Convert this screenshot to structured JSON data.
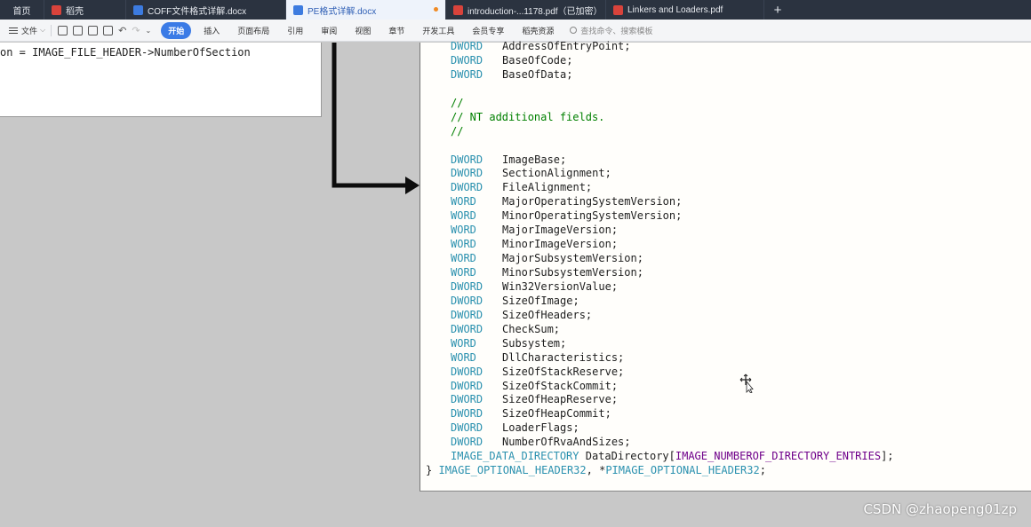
{
  "tabs": [
    {
      "label": "首页",
      "icon": null
    },
    {
      "label": "稻壳",
      "icon": "docer-icon"
    },
    {
      "label": "COFF文件格式详解.docx",
      "icon": "word-doc-icon"
    },
    {
      "label": "PE格式详解.docx",
      "icon": "word-doc-icon",
      "active": true,
      "unsaved": true
    },
    {
      "label": "introduction-...1178.pdf（已加密）",
      "icon": "pdf-icon"
    },
    {
      "label": "Linkers and Loaders.pdf",
      "icon": "pdf-icon"
    }
  ],
  "new_tab_label": "+",
  "ribbon": {
    "file_label": "文件",
    "tabs": [
      "开始",
      "插入",
      "页面布局",
      "引用",
      "审阅",
      "视图",
      "章节",
      "开发工具",
      "会员专享",
      "稻壳资源"
    ],
    "active_tab": "开始",
    "search_placeholder": "查找命令、搜索模板"
  },
  "left_doc": {
    "code_line": "on = IMAGE_FILE_HEADER->NumberOfSection"
  },
  "code_lines": [
    {
      "kind": "field",
      "type": "DWORD",
      "name": "AddressOfEntryPoint;"
    },
    {
      "kind": "field",
      "type": "DWORD",
      "name": "BaseOfCode;"
    },
    {
      "kind": "field",
      "type": "DWORD",
      "name": "BaseOfData;"
    },
    {
      "kind": "blank"
    },
    {
      "kind": "comment",
      "text": "//"
    },
    {
      "kind": "comment",
      "text": "// NT additional fields."
    },
    {
      "kind": "comment",
      "text": "//"
    },
    {
      "kind": "blank"
    },
    {
      "kind": "field",
      "type": "DWORD",
      "name": "ImageBase;"
    },
    {
      "kind": "field",
      "type": "DWORD",
      "name": "SectionAlignment;"
    },
    {
      "kind": "field",
      "type": "DWORD",
      "name": "FileAlignment;"
    },
    {
      "kind": "field",
      "type": "WORD",
      "name": "MajorOperatingSystemVersion;"
    },
    {
      "kind": "field",
      "type": "WORD",
      "name": "MinorOperatingSystemVersion;"
    },
    {
      "kind": "field",
      "type": "WORD",
      "name": "MajorImageVersion;"
    },
    {
      "kind": "field",
      "type": "WORD",
      "name": "MinorImageVersion;"
    },
    {
      "kind": "field",
      "type": "WORD",
      "name": "MajorSubsystemVersion;"
    },
    {
      "kind": "field",
      "type": "WORD",
      "name": "MinorSubsystemVersion;"
    },
    {
      "kind": "field",
      "type": "DWORD",
      "name": "Win32VersionValue;"
    },
    {
      "kind": "field",
      "type": "DWORD",
      "name": "SizeOfImage;"
    },
    {
      "kind": "field",
      "type": "DWORD",
      "name": "SizeOfHeaders;"
    },
    {
      "kind": "field",
      "type": "DWORD",
      "name": "CheckSum;"
    },
    {
      "kind": "field",
      "type": "WORD",
      "name": "Subsystem;"
    },
    {
      "kind": "field",
      "type": "WORD",
      "name": "DllCharacteristics;"
    },
    {
      "kind": "field",
      "type": "DWORD",
      "name": "SizeOfStackReserve;"
    },
    {
      "kind": "field",
      "type": "DWORD",
      "name": "SizeOfStackCommit;"
    },
    {
      "kind": "field",
      "type": "DWORD",
      "name": "SizeOfHeapReserve;"
    },
    {
      "kind": "field",
      "type": "DWORD",
      "name": "SizeOfHeapCommit;"
    },
    {
      "kind": "field",
      "type": "DWORD",
      "name": "LoaderFlags;"
    },
    {
      "kind": "field",
      "type": "DWORD",
      "name": "NumberOfRvaAndSizes;"
    }
  ],
  "data_directory_line": {
    "type": "IMAGE_DATA_DIRECTORY",
    "name": " DataDirectory[",
    "macro": "IMAGE_NUMBEROF_DIRECTORY_ENTRIES",
    "end": "];"
  },
  "closing_line": {
    "brace": "}",
    "type1": "IMAGE_OPTIONAL_HEADER32",
    "sep": ", *",
    "type2": "PIMAGE_OPTIONAL_HEADER32",
    "end": ";"
  },
  "watermark": "CSDN @zhaopeng01zp",
  "colors": {
    "keyword": "#2b91af",
    "comment": "#008000",
    "macro": "#6f008a",
    "active_ribbon_tab": "#3b7be6"
  }
}
